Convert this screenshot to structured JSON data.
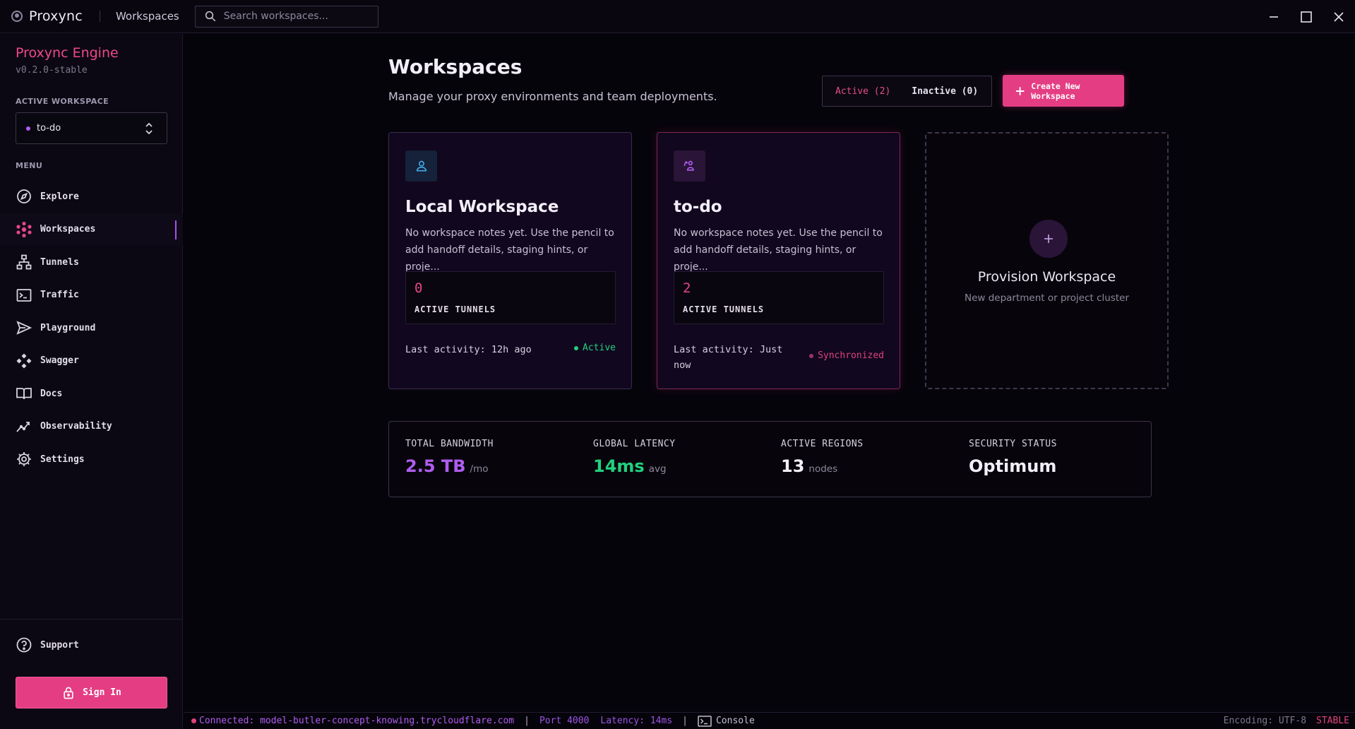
{
  "titlebar": {
    "app_name": "Proxync",
    "breadcrumb": "Workspaces",
    "search_placeholder": "Search workspaces..."
  },
  "sidebar": {
    "engine_title": "Proxync Engine",
    "version": "v0.2.0-stable",
    "active_workspace_label": "ACTIVE WORKSPACE",
    "active_workspace_value": "to-do",
    "menu_label": "MENU",
    "items": [
      {
        "label": "Explore",
        "icon": "compass-icon"
      },
      {
        "label": "Workspaces",
        "icon": "hub-icon"
      },
      {
        "label": "Tunnels",
        "icon": "network-icon"
      },
      {
        "label": "Traffic",
        "icon": "terminal-icon"
      },
      {
        "label": "Playground",
        "icon": "send-icon"
      },
      {
        "label": "Swagger",
        "icon": "api-icon"
      },
      {
        "label": "Docs",
        "icon": "book-icon"
      },
      {
        "label": "Observability",
        "icon": "trend-icon"
      },
      {
        "label": "Settings",
        "icon": "gear-icon"
      }
    ],
    "active_item": "Workspaces",
    "support_label": "Support",
    "sign_in_label": "Sign In"
  },
  "main": {
    "title": "Workspaces",
    "subtitle": "Manage your proxy environments and team deployments.",
    "filter_active": "Active (2)",
    "filter_inactive": "Inactive (0)",
    "create_button": "Create New Workspace",
    "cards": [
      {
        "title": "Local Workspace",
        "description": "No workspace notes yet. Use the pencil to add handoff details, staging hints, or proje...",
        "tunnels": "0",
        "tunnels_label": "ACTIVE TUNNELS",
        "last_activity": "Last activity: 12h ago",
        "status": "Active",
        "status_color": "#22d07f",
        "icon": "user-icon"
      },
      {
        "title": "to-do",
        "description": "No workspace notes yet. Use the pencil to add handoff details, staging hints, or proje...",
        "tunnels": "2",
        "tunnels_label": "ACTIVE TUNNELS",
        "last_activity": "Last activity: Just now",
        "status": "Synchronized",
        "status_color": "#e0427e",
        "icon": "sync-user-icon"
      }
    ],
    "provision": {
      "title": "Provision Workspace",
      "subtitle": "New department or project cluster"
    },
    "stats": [
      {
        "label": "TOTAL BANDWIDTH",
        "value": "2.5 TB",
        "unit": "/mo",
        "color": "#b05cf0"
      },
      {
        "label": "GLOBAL LATENCY",
        "value": "14ms",
        "unit": "avg",
        "color": "#22d07f"
      },
      {
        "label": "ACTIVE REGIONS",
        "value": "13",
        "unit": "nodes",
        "color": "#f3eff9"
      },
      {
        "label": "SECURITY STATUS",
        "value": "Optimum",
        "unit": "",
        "color": "#f3eff9"
      }
    ]
  },
  "statusbar": {
    "connection": "Connected: model-butler-concept-knowing.trycloudflare.com",
    "port": "Port 4000",
    "latency": "Latency: 14ms",
    "console": "Console",
    "encoding": "Encoding: UTF-8",
    "channel": "STABLE"
  },
  "colors": {
    "accent_pink": "#e53d83",
    "accent_purple": "#b05cf0",
    "success": "#22d07f"
  }
}
